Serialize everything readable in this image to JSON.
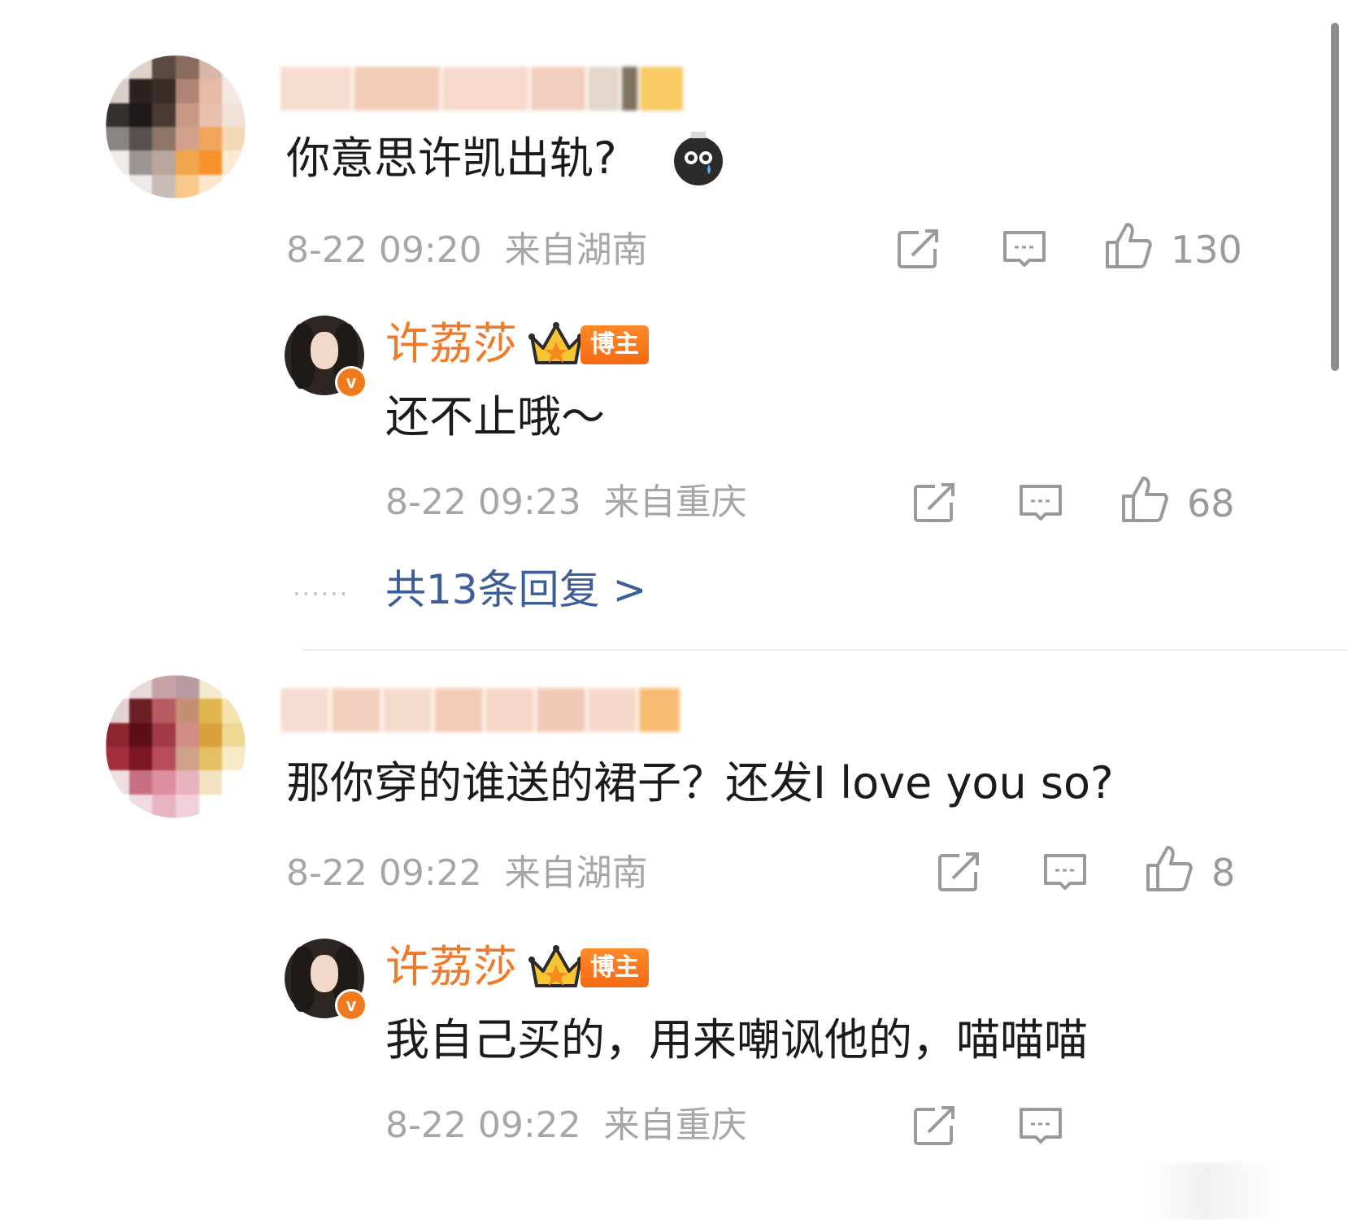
{
  "comments": [
    {
      "text": "你意思许凯出轨?",
      "emoji": "crying-face-emoji",
      "date": "8-22 09:20",
      "location": "来自湖南",
      "likes": "130",
      "reply": {
        "author": "许荔莎",
        "badge": "博主",
        "text": "还不止哦～",
        "date": "8-22 09:23",
        "location": "来自重庆",
        "likes": "68"
      },
      "more_replies": "共13条回复 >"
    },
    {
      "text": "那你穿的谁送的裙子？还发I love you so?",
      "date": "8-22 09:22",
      "location": "来自湖南",
      "likes": "8",
      "reply": {
        "author": "许荔莎",
        "badge": "博主",
        "text": "我自己买的，用来嘲讽他的，喵喵喵",
        "date": "8-22 09:22",
        "location": "来自重庆"
      }
    }
  ],
  "icons": {
    "share": "share-icon",
    "comment": "comment-icon",
    "like": "thumbs-up-icon",
    "crown": "crown-icon",
    "verified": "verified-v-icon"
  },
  "colors": {
    "author": "#f0792a",
    "badge": "#f56a12",
    "link": "#3c5e99",
    "meta": "#a6a6a6"
  }
}
